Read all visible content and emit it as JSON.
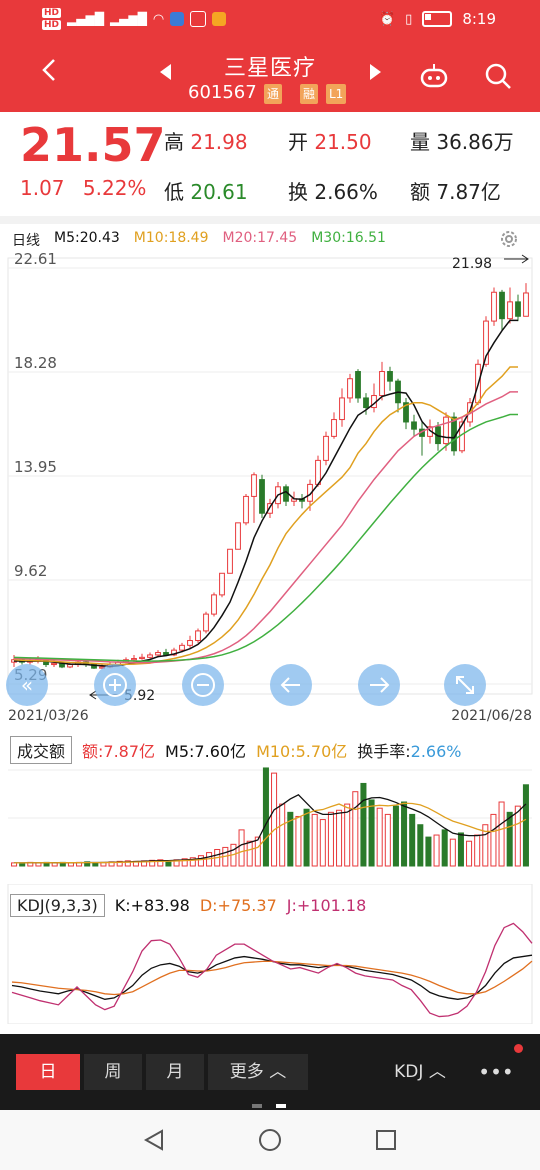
{
  "status": {
    "time": "8:19",
    "hd1": "HD",
    "hd2": "HD",
    "net1": "4G",
    "net2": "4G"
  },
  "header": {
    "title": "三星医疗",
    "code": "601567",
    "tag1": "通",
    "tag2": "融",
    "tag3": "L1"
  },
  "quote": {
    "price": "21.57",
    "change": "1.07",
    "change_pct": "5.22%",
    "high_label": "高",
    "high": "21.98",
    "low_label": "低",
    "low": "20.61",
    "open_label": "开",
    "open": "21.50",
    "turn_label": "换",
    "turn": "2.66%",
    "vol_label": "量",
    "vol": "36.86万",
    "amt_label": "额",
    "amt": "7.87亿"
  },
  "kline": {
    "period": "日线",
    "m5": "M5:20.43",
    "m10": "M10:18.49",
    "m20": "M20:17.45",
    "m30": "M30:16.51",
    "y_ticks": [
      "22.61",
      "18.28",
      "13.95",
      "9.62",
      "5.29"
    ],
    "max_label": "21.98",
    "min_label": "5.92",
    "date_start": "2021/03/26",
    "date_end": "2021/06/28",
    "colors": {
      "m5": "#111111",
      "m10": "#e0a020",
      "m20": "#e06080",
      "m30": "#40b040",
      "up": "#e8393b",
      "down": "#2a7a2a"
    }
  },
  "chart_data": {
    "type": "candlestick",
    "ylim": [
      5.29,
      22.61
    ],
    "y_ticks": [
      22.61,
      18.28,
      13.95,
      9.62,
      5.29
    ],
    "x_start": "2021/03/26",
    "x_end": "2021/06/28",
    "candles": [
      {
        "o": 6.2,
        "c": 6.3,
        "h": 6.5,
        "l": 6.0
      },
      {
        "o": 6.3,
        "c": 6.2,
        "h": 6.4,
        "l": 6.1
      },
      {
        "o": 6.2,
        "c": 6.25,
        "h": 6.4,
        "l": 6.1
      },
      {
        "o": 6.25,
        "c": 6.3,
        "h": 6.45,
        "l": 6.15
      },
      {
        "o": 6.3,
        "c": 6.1,
        "h": 6.35,
        "l": 6.0
      },
      {
        "o": 6.1,
        "c": 6.15,
        "h": 6.3,
        "l": 6.0
      },
      {
        "o": 6.15,
        "c": 6.0,
        "h": 6.2,
        "l": 5.95
      },
      {
        "o": 6.0,
        "c": 6.1,
        "h": 6.2,
        "l": 5.95
      },
      {
        "o": 6.1,
        "c": 6.2,
        "h": 6.3,
        "l": 6.0
      },
      {
        "o": 6.2,
        "c": 6.1,
        "h": 6.3,
        "l": 6.0
      },
      {
        "o": 6.1,
        "c": 5.95,
        "h": 6.15,
        "l": 5.92
      },
      {
        "o": 5.95,
        "c": 6.0,
        "h": 6.1,
        "l": 5.92
      },
      {
        "o": 6.0,
        "c": 6.1,
        "h": 6.2,
        "l": 5.95
      },
      {
        "o": 6.1,
        "c": 6.2,
        "h": 6.3,
        "l": 6.05
      },
      {
        "o": 6.2,
        "c": 6.3,
        "h": 6.4,
        "l": 6.15
      },
      {
        "o": 6.3,
        "c": 6.35,
        "h": 6.5,
        "l": 6.2
      },
      {
        "o": 6.35,
        "c": 6.4,
        "h": 6.55,
        "l": 6.3
      },
      {
        "o": 6.4,
        "c": 6.5,
        "h": 6.6,
        "l": 6.35
      },
      {
        "o": 6.5,
        "c": 6.6,
        "h": 6.7,
        "l": 6.4
      },
      {
        "o": 6.6,
        "c": 6.5,
        "h": 6.75,
        "l": 6.45
      },
      {
        "o": 6.5,
        "c": 6.7,
        "h": 6.8,
        "l": 6.45
      },
      {
        "o": 6.7,
        "c": 6.9,
        "h": 7.0,
        "l": 6.6
      },
      {
        "o": 6.9,
        "c": 7.1,
        "h": 7.3,
        "l": 6.8
      },
      {
        "o": 7.1,
        "c": 7.5,
        "h": 7.6,
        "l": 7.0
      },
      {
        "o": 7.5,
        "c": 8.2,
        "h": 8.3,
        "l": 7.4
      },
      {
        "o": 8.2,
        "c": 9.0,
        "h": 9.1,
        "l": 8.1
      },
      {
        "o": 9.0,
        "c": 9.9,
        "h": 9.9,
        "l": 8.9
      },
      {
        "o": 9.9,
        "c": 10.9,
        "h": 10.9,
        "l": 9.9
      },
      {
        "o": 10.9,
        "c": 12.0,
        "h": 12.0,
        "l": 10.9
      },
      {
        "o": 12.0,
        "c": 13.1,
        "h": 13.2,
        "l": 11.9
      },
      {
        "o": 13.1,
        "c": 14.0,
        "h": 14.1,
        "l": 12.0
      },
      {
        "o": 13.8,
        "c": 12.4,
        "h": 14.0,
        "l": 12.2
      },
      {
        "o": 12.4,
        "c": 12.8,
        "h": 13.0,
        "l": 12.2
      },
      {
        "o": 12.8,
        "c": 13.5,
        "h": 13.7,
        "l": 12.6
      },
      {
        "o": 13.5,
        "c": 12.9,
        "h": 13.6,
        "l": 12.7
      },
      {
        "o": 12.9,
        "c": 13.0,
        "h": 13.3,
        "l": 12.7
      },
      {
        "o": 13.0,
        "c": 12.9,
        "h": 13.2,
        "l": 12.6
      },
      {
        "o": 12.9,
        "c": 13.6,
        "h": 13.8,
        "l": 12.5
      },
      {
        "o": 13.6,
        "c": 14.6,
        "h": 14.8,
        "l": 13.5
      },
      {
        "o": 14.6,
        "c": 15.6,
        "h": 15.8,
        "l": 14.4
      },
      {
        "o": 15.6,
        "c": 16.3,
        "h": 16.6,
        "l": 15.5
      },
      {
        "o": 16.3,
        "c": 17.2,
        "h": 17.6,
        "l": 16.0
      },
      {
        "o": 17.2,
        "c": 18.0,
        "h": 18.2,
        "l": 17.0
      },
      {
        "o": 18.3,
        "c": 17.2,
        "h": 18.4,
        "l": 17.0
      },
      {
        "o": 17.2,
        "c": 16.8,
        "h": 17.4,
        "l": 16.5
      },
      {
        "o": 16.8,
        "c": 17.3,
        "h": 17.8,
        "l": 16.6
      },
      {
        "o": 17.3,
        "c": 18.3,
        "h": 18.7,
        "l": 17.1
      },
      {
        "o": 18.3,
        "c": 17.9,
        "h": 18.5,
        "l": 17.5
      },
      {
        "o": 17.9,
        "c": 17.0,
        "h": 18.0,
        "l": 16.6
      },
      {
        "o": 17.0,
        "c": 16.2,
        "h": 17.2,
        "l": 15.9
      },
      {
        "o": 16.2,
        "c": 15.9,
        "h": 16.5,
        "l": 15.6
      },
      {
        "o": 15.9,
        "c": 15.6,
        "h": 16.2,
        "l": 14.8
      },
      {
        "o": 15.6,
        "c": 16.0,
        "h": 16.3,
        "l": 15.3
      },
      {
        "o": 16.0,
        "c": 15.3,
        "h": 16.2,
        "l": 15.0
      },
      {
        "o": 15.3,
        "c": 16.4,
        "h": 16.6,
        "l": 15.0
      },
      {
        "o": 16.4,
        "c": 15.0,
        "h": 16.6,
        "l": 14.8
      },
      {
        "o": 15.0,
        "c": 16.2,
        "h": 16.4,
        "l": 14.9
      },
      {
        "o": 16.2,
        "c": 17.0,
        "h": 17.2,
        "l": 16.0
      },
      {
        "o": 17.0,
        "c": 18.6,
        "h": 18.8,
        "l": 16.9
      },
      {
        "o": 18.6,
        "c": 20.4,
        "h": 20.6,
        "l": 18.5
      },
      {
        "o": 20.4,
        "c": 21.6,
        "h": 21.8,
        "l": 20.2
      },
      {
        "o": 21.6,
        "c": 20.5,
        "h": 21.7,
        "l": 20.0
      },
      {
        "o": 20.5,
        "c": 21.2,
        "h": 21.8,
        "l": 20.3
      },
      {
        "o": 21.2,
        "c": 20.6,
        "h": 21.5,
        "l": 20.4
      },
      {
        "o": 20.6,
        "c": 21.57,
        "h": 21.98,
        "l": 20.61
      }
    ],
    "ma5": [
      6.25,
      6.25,
      6.24,
      6.24,
      6.24,
      6.2,
      6.16,
      6.12,
      6.11,
      6.1,
      6.07,
      6.05,
      6.03,
      6.05,
      6.11,
      6.17,
      6.25,
      6.31,
      6.43,
      6.47,
      6.54,
      6.64,
      6.76,
      6.94,
      7.24,
      7.64,
      8.14,
      8.7,
      9.52,
      10.4,
      11.38,
      12.08,
      12.66,
      13.16,
      13.3,
      13.0,
      12.98,
      13.18,
      13.6,
      14.08,
      14.7,
      15.32,
      15.94,
      16.48,
      16.7,
      16.96,
      17.26,
      17.36,
      17.44,
      17.4,
      16.9,
      16.22,
      15.84,
      15.62,
      15.56,
      15.54,
      16.08,
      16.66,
      17.74,
      18.94,
      19.5,
      20.0,
      20.43,
      20.43
    ],
    "ma10": [
      6.3,
      6.28,
      6.27,
      6.26,
      6.25,
      6.23,
      6.21,
      6.19,
      6.18,
      6.17,
      6.15,
      6.13,
      6.11,
      6.1,
      6.11,
      6.12,
      6.14,
      6.16,
      6.23,
      6.29,
      6.35,
      6.43,
      6.52,
      6.64,
      6.8,
      7.0,
      7.25,
      7.55,
      7.95,
      8.45,
      9.02,
      9.66,
      10.25,
      10.95,
      11.55,
      11.97,
      12.35,
      12.7,
      13.0,
      13.3,
      13.6,
      13.9,
      14.3,
      14.9,
      15.3,
      15.8,
      16.2,
      16.5,
      16.7,
      16.9,
      17.0,
      17.0,
      16.9,
      16.7,
      16.5,
      16.3,
      16.4,
      16.6,
      17.0,
      17.5,
      17.8,
      18.1,
      18.49,
      18.49
    ],
    "ma20": [
      6.35,
      6.34,
      6.33,
      6.32,
      6.31,
      6.3,
      6.29,
      6.28,
      6.27,
      6.26,
      6.25,
      6.23,
      6.21,
      6.2,
      6.19,
      6.18,
      6.18,
      6.18,
      6.2,
      6.22,
      6.25,
      6.28,
      6.32,
      6.38,
      6.45,
      6.55,
      6.68,
      6.85,
      7.05,
      7.3,
      7.6,
      7.95,
      8.3,
      8.7,
      9.1,
      9.5,
      9.9,
      10.3,
      10.7,
      11.1,
      11.5,
      11.9,
      12.4,
      12.9,
      13.35,
      13.8,
      14.2,
      14.6,
      15.0,
      15.3,
      15.6,
      15.8,
      15.95,
      16.05,
      16.15,
      16.25,
      16.4,
      16.55,
      16.75,
      16.95,
      17.1,
      17.25,
      17.45,
      17.45
    ],
    "ma30": [
      6.4,
      6.39,
      6.38,
      6.37,
      6.36,
      6.35,
      6.34,
      6.33,
      6.32,
      6.31,
      6.3,
      6.29,
      6.28,
      6.27,
      6.26,
      6.25,
      6.24,
      6.24,
      6.25,
      6.26,
      6.27,
      6.29,
      6.31,
      6.34,
      6.38,
      6.43,
      6.5,
      6.6,
      6.72,
      6.87,
      7.05,
      7.26,
      7.5,
      7.76,
      8.05,
      8.35,
      8.67,
      9.0,
      9.35,
      9.7,
      10.06,
      10.43,
      10.82,
      11.22,
      11.62,
      12.02,
      12.42,
      12.82,
      13.2,
      13.58,
      13.95,
      14.3,
      14.62,
      14.92,
      15.2,
      15.45,
      15.68,
      15.88,
      16.05,
      16.2,
      16.3,
      16.4,
      16.51,
      16.51
    ]
  },
  "volume": {
    "title": "成交额",
    "amt": "额:7.87亿",
    "m5": "M5:7.60亿",
    "m10": "M10:5.70亿",
    "turn_label": "换手率:",
    "turn": "2.66%",
    "values": [
      0.3,
      0.3,
      0.35,
      0.3,
      0.35,
      0.3,
      0.35,
      0.3,
      0.35,
      0.4,
      0.3,
      0.35,
      0.4,
      0.45,
      0.5,
      0.45,
      0.5,
      0.55,
      0.6,
      0.5,
      0.6,
      0.7,
      0.8,
      1.0,
      1.3,
      1.6,
      1.8,
      2.1,
      3.5,
      2.4,
      2.8,
      9.5,
      9.0,
      6.0,
      5.2,
      4.8,
      5.5,
      5.0,
      4.5,
      5.2,
      5.4,
      6.0,
      7.2,
      8.0,
      6.4,
      5.6,
      5.0,
      5.8,
      6.2,
      5.0,
      4.0,
      2.8,
      3.0,
      3.5,
      2.6,
      3.2,
      2.4,
      3.0,
      4.0,
      5.0,
      6.2,
      5.2,
      5.8,
      7.87
    ]
  },
  "kdj": {
    "title": "KDJ(9,3,3)",
    "k": "K:+83.98",
    "d": "D:+75.37",
    "j": "J:+101.18",
    "kvals": [
      40,
      38,
      35,
      32,
      30,
      28,
      32,
      35,
      30,
      25,
      20,
      22,
      30,
      40,
      55,
      65,
      70,
      72,
      68,
      60,
      58,
      62,
      70,
      75,
      80,
      82,
      80,
      78,
      75,
      72,
      70,
      70,
      68,
      66,
      68,
      70,
      68,
      65,
      62,
      60,
      58,
      56,
      52,
      48,
      40,
      30,
      25,
      22,
      20,
      22,
      28,
      40,
      58,
      72,
      80,
      82,
      83.98
    ],
    "dvals": [
      45,
      44,
      42,
      40,
      38,
      36,
      35,
      34,
      33,
      31,
      28,
      27,
      28,
      31,
      38,
      45,
      52,
      58,
      62,
      62,
      61,
      61,
      63,
      66,
      70,
      73,
      74,
      75,
      75,
      74,
      73,
      72,
      71,
      70,
      69,
      69,
      69,
      68,
      66,
      64,
      62,
      60,
      58,
      55,
      51,
      46,
      40,
      35,
      30,
      28,
      28,
      31,
      38,
      46,
      55,
      64,
      75.37
    ],
    "jvals": [
      30,
      26,
      22,
      18,
      15,
      12,
      25,
      38,
      25,
      12,
      5,
      10,
      35,
      60,
      90,
      105,
      106,
      100,
      80,
      56,
      52,
      64,
      84,
      92,
      100,
      100,
      92,
      84,
      76,
      70,
      64,
      66,
      62,
      58,
      66,
      72,
      66,
      58,
      54,
      52,
      50,
      48,
      40,
      34,
      18,
      0,
      -5,
      -4,
      0,
      10,
      30,
      60,
      98,
      124,
      130,
      118,
      101.18
    ]
  },
  "bottom": {
    "tab1": "日",
    "tab2": "周",
    "tab3": "月",
    "tab4": "更多",
    "tab5": "KDJ",
    "more": "•••"
  }
}
